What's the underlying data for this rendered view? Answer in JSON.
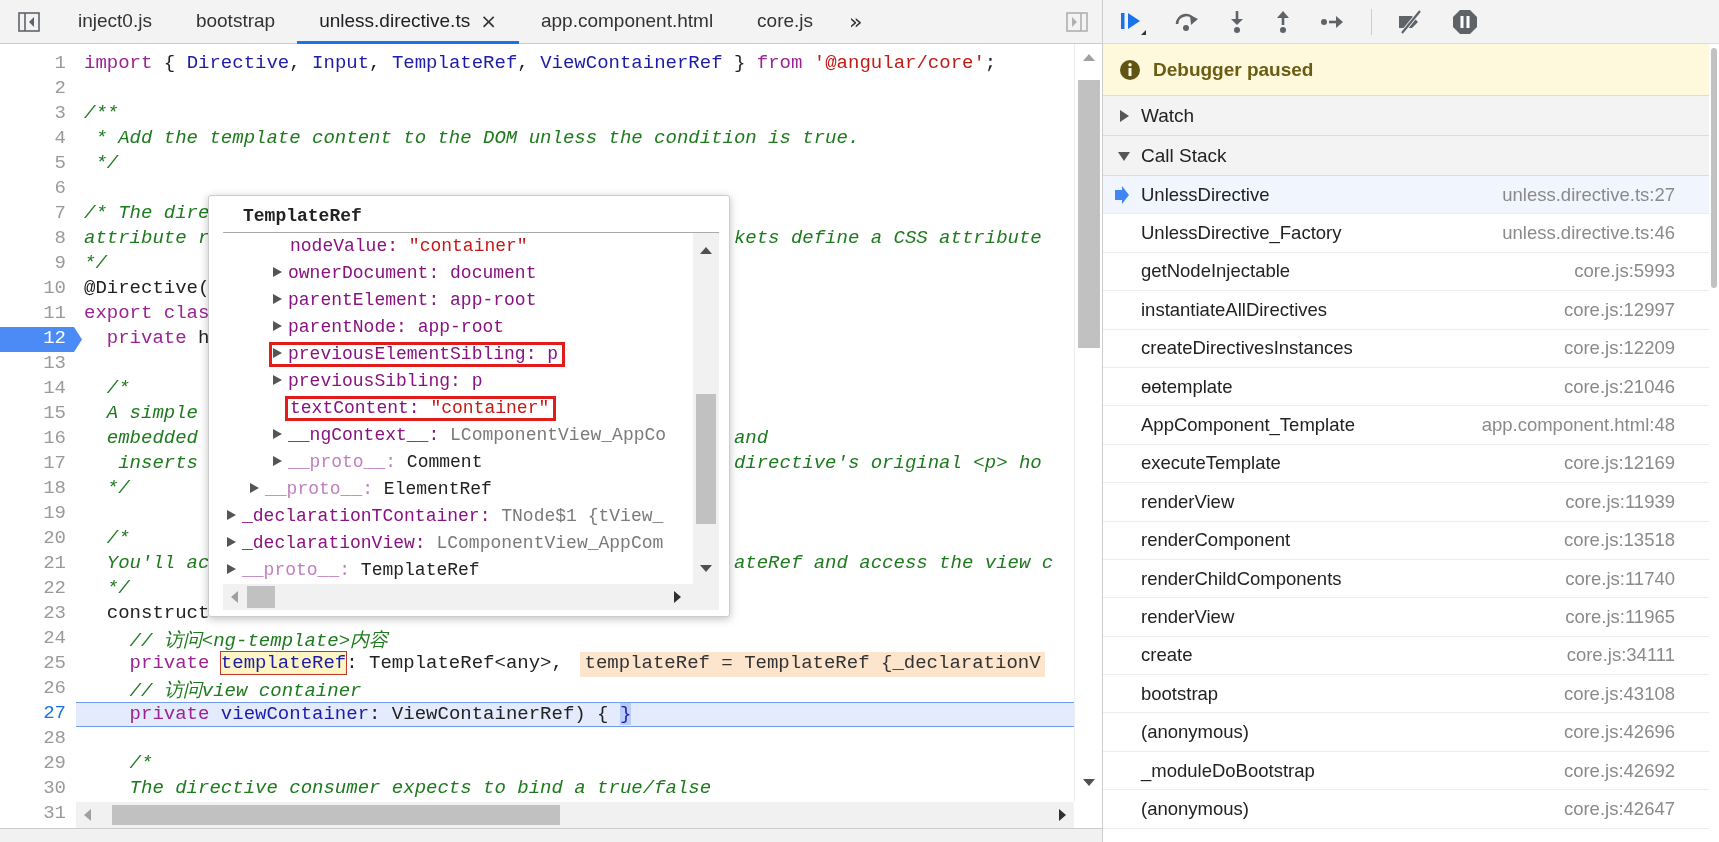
{
  "editor": {
    "tabs": [
      {
        "label": "inject0.js",
        "selected": false
      },
      {
        "label": "bootstrap",
        "selected": false
      },
      {
        "label": "unless.directive.ts",
        "selected": true,
        "close": "×"
      },
      {
        "label": "app.component.html",
        "selected": false
      },
      {
        "label": "core.js",
        "selected": false
      }
    ],
    "overflow": "»",
    "lines": [
      {
        "number": "1",
        "breakpoint": false,
        "current": false,
        "tokens": [
          {
            "kind": "keyword",
            "text": "import"
          },
          {
            "kind": "plain",
            "text": " { "
          },
          {
            "kind": "name",
            "text": "Directive"
          },
          {
            "kind": "plain",
            "text": ", "
          },
          {
            "kind": "name",
            "text": "Input"
          },
          {
            "kind": "plain",
            "text": ", "
          },
          {
            "kind": "name",
            "text": "TemplateRef"
          },
          {
            "kind": "plain",
            "text": ", "
          },
          {
            "kind": "name",
            "text": "ViewContainerRef"
          },
          {
            "kind": "plain",
            "text": " } "
          },
          {
            "kind": "keyword",
            "text": "from "
          },
          {
            "kind": "string",
            "text": "'@angular/core'"
          },
          {
            "kind": "plain",
            "text": ";"
          }
        ]
      },
      {
        "number": "2",
        "breakpoint": false,
        "current": false
      },
      {
        "number": "3",
        "breakpoint": false,
        "current": false,
        "tokens": [
          {
            "kind": "comment",
            "text": "/**"
          }
        ]
      },
      {
        "number": "4",
        "breakpoint": false,
        "current": false,
        "tokens": [
          {
            "kind": "comment",
            "text": " * Add the template content to the DOM unless the condition is true."
          }
        ]
      },
      {
        "number": "5",
        "breakpoint": false,
        "current": false,
        "tokens": [
          {
            "kind": "comment",
            "text": " */"
          }
        ]
      },
      {
        "number": "6",
        "breakpoint": false,
        "current": false
      },
      {
        "number": "7",
        "breakpoint": false,
        "current": false,
        "tokens": [
          {
            "kind": "comment",
            "text": "/* The dire"
          }
        ]
      },
      {
        "number": "8",
        "breakpoint": false,
        "current": false,
        "tokens": [
          {
            "kind": "comment",
            "text": "attribute r"
          }
        ],
        "right": [
          {
            "kind": "comment",
            "text": "kets define a CSS attribute"
          }
        ]
      },
      {
        "number": "9",
        "breakpoint": false,
        "current": false,
        "tokens": [
          {
            "kind": "comment",
            "text": "*/"
          }
        ]
      },
      {
        "number": "10",
        "breakpoint": false,
        "current": false,
        "tokens": [
          {
            "kind": "plain",
            "text": "@Directive("
          }
        ]
      },
      {
        "number": "11",
        "breakpoint": false,
        "current": false,
        "tokens": [
          {
            "kind": "keyword",
            "text": "export clas"
          }
        ]
      },
      {
        "number": "12",
        "breakpoint": true,
        "current": false,
        "tokens": [
          {
            "kind": "keyword",
            "text": "  private"
          },
          {
            "kind": "plain",
            "text": " h"
          }
        ]
      },
      {
        "number": "13",
        "breakpoint": false,
        "current": false
      },
      {
        "number": "14",
        "breakpoint": false,
        "current": false,
        "tokens": [
          {
            "kind": "comment",
            "text": "  /*"
          }
        ]
      },
      {
        "number": "15",
        "breakpoint": false,
        "current": false,
        "tokens": [
          {
            "kind": "comment",
            "text": "  A simple"
          }
        ]
      },
      {
        "number": "16",
        "breakpoint": false,
        "current": false,
        "tokens": [
          {
            "kind": "comment",
            "text": "  embedded"
          }
        ],
        "right": [
          {
            "kind": "comment",
            "text": "and"
          }
        ]
      },
      {
        "number": "17",
        "breakpoint": false,
        "current": false,
        "tokens": [
          {
            "kind": "comment",
            "text": "   inserts"
          }
        ],
        "right": [
          {
            "kind": "comment",
            "text": "directive's original <p> ho"
          }
        ]
      },
      {
        "number": "18",
        "breakpoint": false,
        "current": false,
        "tokens": [
          {
            "kind": "comment",
            "text": "  */"
          }
        ]
      },
      {
        "number": "19",
        "breakpoint": false,
        "current": false
      },
      {
        "number": "20",
        "breakpoint": false,
        "current": false,
        "tokens": [
          {
            "kind": "comment",
            "text": "  /*"
          }
        ]
      },
      {
        "number": "21",
        "breakpoint": false,
        "current": false,
        "tokens": [
          {
            "kind": "comment",
            "text": "  You'll ac"
          }
        ],
        "right": [
          {
            "kind": "comment",
            "text": "ateRef and access the view c"
          }
        ]
      },
      {
        "number": "22",
        "breakpoint": false,
        "current": false,
        "tokens": [
          {
            "kind": "comment",
            "text": "  */"
          }
        ]
      },
      {
        "number": "23",
        "breakpoint": false,
        "current": false,
        "tokens": [
          {
            "kind": "plain",
            "text": "  construct"
          }
        ]
      },
      {
        "number": "24",
        "breakpoint": false,
        "current": false,
        "tokens": [
          {
            "kind": "comment",
            "text": "    // 访问<ng-template>内容"
          }
        ]
      },
      {
        "number": "25",
        "breakpoint": false,
        "current": false,
        "tokens": [
          {
            "kind": "keyword",
            "text": "    private "
          },
          {
            "kind": "hover",
            "text": "templateRef"
          },
          {
            "kind": "plain",
            "text": ": TemplateRef<any>,"
          }
        ],
        "inline_value": "templateRef = TemplateRef {_declarationV"
      },
      {
        "number": "26",
        "breakpoint": false,
        "current": false,
        "tokens": [
          {
            "kind": "comment",
            "text": "    // 访问view container"
          }
        ]
      },
      {
        "number": "27",
        "breakpoint": false,
        "current": true,
        "tokens": [
          {
            "kind": "keyword",
            "text": "    private "
          },
          {
            "kind": "name",
            "text": "viewContainer"
          },
          {
            "kind": "plain",
            "text": ": ViewContainerRef) { "
          },
          {
            "kind": "paused",
            "text": "}"
          }
        ]
      },
      {
        "number": "28",
        "breakpoint": false,
        "current": false
      },
      {
        "number": "29",
        "breakpoint": false,
        "current": false,
        "tokens": [
          {
            "kind": "comment",
            "text": "    /*"
          }
        ]
      },
      {
        "number": "30",
        "breakpoint": false,
        "current": false,
        "tokens": [
          {
            "kind": "comment",
            "text": "    The directive consumer expects to bind a true/false"
          }
        ]
      },
      {
        "number": "31",
        "breakpoint": false,
        "current": false
      }
    ],
    "popover": {
      "title": "TemplateRef",
      "tree": [
        {
          "children": [
            {
              "children": [
                {
                  "name": "nodeValue:",
                  "value": "\"container\"",
                  "kind": "string",
                  "expandable": false,
                  "internal": false,
                  "boxed": false
                },
                {
                  "name": "ownerDocument:",
                  "value": "document",
                  "kind": "node",
                  "expandable": true,
                  "internal": false,
                  "boxed": false
                },
                {
                  "name": "parentElement:",
                  "value": "app-root",
                  "kind": "node",
                  "expandable": true,
                  "internal": false,
                  "boxed": false
                },
                {
                  "name": "parentNode:",
                  "value": "app-root",
                  "kind": "node",
                  "expandable": true,
                  "internal": false,
                  "boxed": false
                },
                {
                  "name": "previousElementSibling:",
                  "value": "p",
                  "kind": "node",
                  "expandable": true,
                  "internal": false,
                  "boxed": true
                },
                {
                  "name": "previousSibling:",
                  "value": "p",
                  "kind": "node",
                  "expandable": true,
                  "internal": false,
                  "boxed": false
                },
                {
                  "name": "textContent:",
                  "value": "\"container\"",
                  "kind": "string",
                  "expandable": false,
                  "internal": false,
                  "boxed": true
                },
                {
                  "name": "__ngContext__:",
                  "value": "LComponentView_AppCo",
                  "kind": "object",
                  "expandable": true,
                  "internal": false,
                  "boxed": false
                },
                {
                  "name": "__proto__:",
                  "value": "Comment",
                  "kind": "type",
                  "expandable": true,
                  "internal": true,
                  "boxed": false
                }
              ]
            },
            {
              "name": "__proto__:",
              "value": "ElementRef",
              "kind": "type",
              "expandable": true,
              "internal": true,
              "boxed": false
            }
          ]
        },
        {
          "name": "_declarationTContainer:",
          "value": "TNode$1 {tView_",
          "kind": "object",
          "expandable": true,
          "internal": false,
          "boxed": false
        },
        {
          "name": "_declarationView:",
          "value": "LComponentView_AppCom",
          "kind": "object",
          "expandable": true,
          "internal": false,
          "boxed": false
        },
        {
          "name": "__proto__:",
          "value": "TemplateRef",
          "kind": "type",
          "expandable": true,
          "internal": true,
          "boxed": false
        }
      ]
    }
  },
  "debugger": {
    "banner": "Debugger paused",
    "sections": [
      {
        "label": "Watch",
        "expanded": false
      },
      {
        "label": "Call Stack",
        "expanded": true
      }
    ],
    "call_stack": [
      {
        "name": "UnlessDirective",
        "location": "unless.directive.ts:27",
        "selected": true
      },
      {
        "name": "UnlessDirective_Factory",
        "location": "unless.directive.ts:46",
        "selected": false
      },
      {
        "name": "getNodeInjectable",
        "location": "core.js:5993",
        "selected": false
      },
      {
        "name": "instantiateAllDirectives",
        "location": "core.js:12997",
        "selected": false
      },
      {
        "name": "createDirectivesInstances",
        "location": "core.js:12209",
        "selected": false
      },
      {
        "name": "ɵɵtemplate",
        "location": "core.js:21046",
        "selected": false
      },
      {
        "name": "AppComponent_Template",
        "location": "app.component.html:48",
        "selected": false
      },
      {
        "name": "executeTemplate",
        "location": "core.js:12169",
        "selected": false
      },
      {
        "name": "renderView",
        "location": "core.js:11939",
        "selected": false
      },
      {
        "name": "renderComponent",
        "location": "core.js:13518",
        "selected": false
      },
      {
        "name": "renderChildComponents",
        "location": "core.js:11740",
        "selected": false
      },
      {
        "name": "renderView",
        "location": "core.js:11965",
        "selected": false
      },
      {
        "name": "create",
        "location": "core.js:34111",
        "selected": false
      },
      {
        "name": "bootstrap",
        "location": "core.js:43108",
        "selected": false
      },
      {
        "name": "(anonymous)",
        "location": "core.js:42696",
        "selected": false
      },
      {
        "name": "_moduleDoBootstrap",
        "location": "core.js:42692",
        "selected": false
      },
      {
        "name": "(anonymous)",
        "location": "core.js:42647",
        "selected": false
      }
    ]
  }
}
